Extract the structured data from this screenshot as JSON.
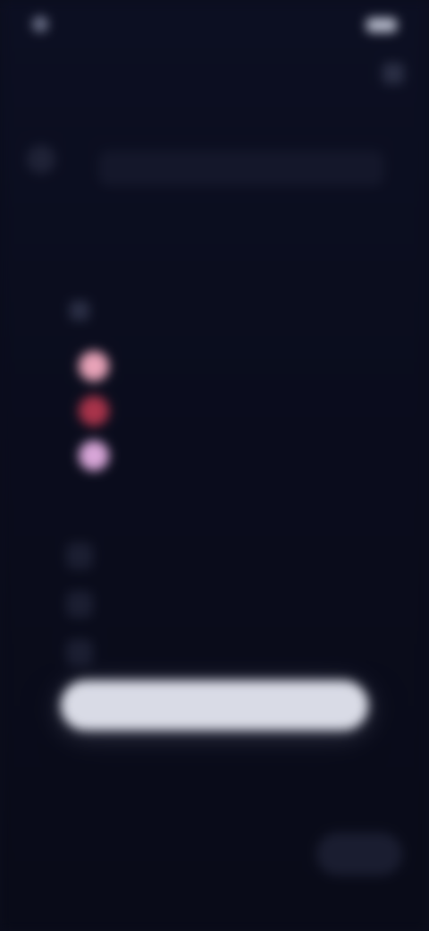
{
  "status_bar": {
    "time": "",
    "icons": ""
  },
  "header": {
    "search_placeholder": ""
  },
  "title": "",
  "section": {
    "label": ""
  },
  "options": [
    {
      "label": "",
      "color": "#e8a3b8"
    },
    {
      "label": "",
      "color": "#a8334a"
    },
    {
      "label": "",
      "color": "#d8a6d8"
    }
  ],
  "note": "",
  "rows": [
    {
      "label": ""
    },
    {
      "label": ""
    },
    {
      "label": ""
    }
  ],
  "primary_button": {
    "label": ""
  },
  "footer": {
    "text": "",
    "button_label": ""
  }
}
